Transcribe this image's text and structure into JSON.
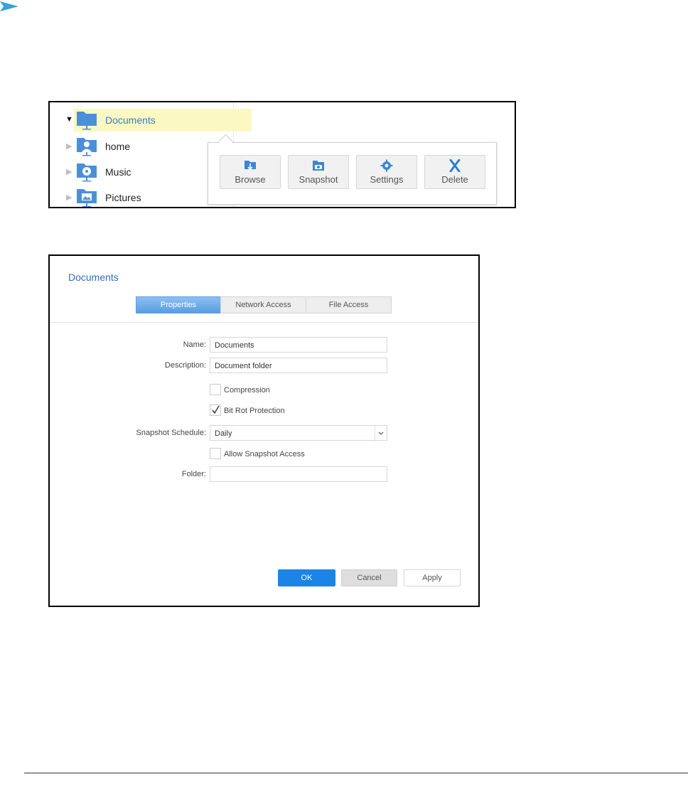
{
  "tree": {
    "items": [
      {
        "label": "Documents",
        "expanded": true,
        "selected": true
      },
      {
        "label": "home",
        "expanded": false,
        "selected": false
      },
      {
        "label": "Music",
        "expanded": false,
        "selected": false
      },
      {
        "label": "Pictures",
        "expanded": false,
        "selected": false
      }
    ]
  },
  "popup": {
    "actions": [
      {
        "label": "Browse",
        "icon": "browse-icon"
      },
      {
        "label": "Snapshot",
        "icon": "snapshot-icon"
      },
      {
        "label": "Settings",
        "icon": "gear-icon"
      },
      {
        "label": "Delete",
        "icon": "delete-icon"
      }
    ]
  },
  "dialog": {
    "title": "Documents",
    "tabs": [
      {
        "label": "Properties",
        "active": true
      },
      {
        "label": "Network Access",
        "active": false
      },
      {
        "label": "File Access",
        "active": false
      }
    ],
    "fields": {
      "name_label": "Name:",
      "name_value": "Documents",
      "description_label": "Description:",
      "description_value": "Document folder",
      "compression_label": "Compression",
      "compression_checked": false,
      "bitrot_label": "Bit Rot Protection",
      "bitrot_checked": true,
      "schedule_label": "Snapshot Schedule:",
      "schedule_value": "Daily",
      "snapshot_access_label": "Allow Snapshot Access",
      "snapshot_access_checked": false,
      "folder_label": "Folder:",
      "folder_value": ""
    },
    "buttons": {
      "ok": "OK",
      "cancel": "Cancel",
      "apply": "Apply"
    }
  },
  "colors": {
    "accent": "#1b84e6",
    "folder": "#4a90d9",
    "selected_row": "#fbf8c2",
    "title_text": "#2f6fb8"
  }
}
